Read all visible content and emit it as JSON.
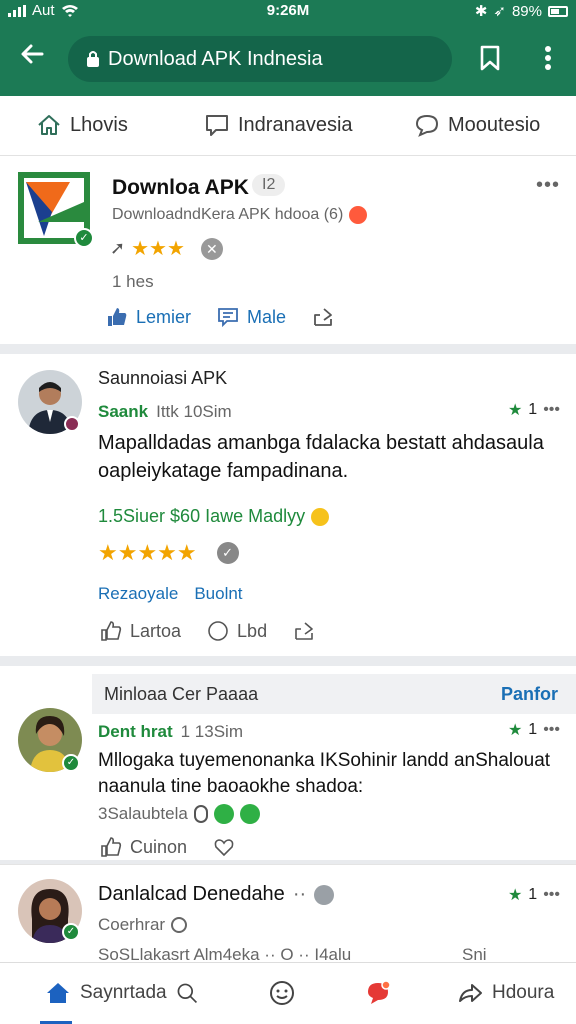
{
  "status": {
    "carrier": "Aut",
    "time": "9:26M",
    "battery": "89%"
  },
  "browser": {
    "url_title": "Download APK Indnesia"
  },
  "tabs": [
    {
      "label": "Lhovis",
      "icon": "home-outline-icon"
    },
    {
      "label": "Indranavesia",
      "icon": "comment-icon"
    },
    {
      "label": "Mooutesio",
      "icon": "chat-bubble-icon"
    }
  ],
  "post": {
    "title": "Downloa APK",
    "badge": "I2",
    "subtitle": "DownloadndKera APK hdooa (6)",
    "time": "1 hes",
    "actions": {
      "like": "Lemier",
      "comment": "Male"
    }
  },
  "review1": {
    "header": "Saunnoiasi APK",
    "author": "Saank",
    "meta": "Ittk 10Sim",
    "rating": "1",
    "body_line1": "Mapalldadas amanbga fdalacka bestatt ahdasaula",
    "body_line2": "oapleiykatage fampadinana.",
    "link_line": "1.5Siuer $60  Iawe Madlyy",
    "links": {
      "left": "Rezaoyale",
      "right": "Buolnt"
    },
    "actions": {
      "like": "Lartoa",
      "love": "Lbd"
    }
  },
  "section": {
    "title": "Minloaa Cer Paaaa",
    "action": "Panfor"
  },
  "review2": {
    "author": "Dent hrat",
    "meta": "1 13Sim",
    "rating": "1",
    "body_line1": "Mllogaka tuyemenonanka IKSohinir landd anShalouat",
    "body_line2": "naanula tine baoaokhe shadoa:",
    "footer": "3Salaubtela",
    "actions": {
      "like": "Cuinon"
    }
  },
  "review3": {
    "author": "Danlalcad Denedahe",
    "author_suffix": "··",
    "meta": "Coerhrar",
    "rating": "1",
    "preview": "SoSLlakasrt Alm4eka ·· O ·· I4alu",
    "preview_right": "Sni"
  },
  "bottomnav": [
    {
      "label": "Saynrtada",
      "icon": "home-icon"
    },
    {
      "label": "",
      "icon": "emoji-icon"
    },
    {
      "label": "",
      "icon": "notification-icon"
    },
    {
      "label": "Hdoura",
      "icon": "share-icon"
    }
  ],
  "colors": {
    "brand": "#1c7a55",
    "link": "#1a6fb5",
    "star": "#f2a400",
    "accent_green": "#1f8a3c"
  }
}
